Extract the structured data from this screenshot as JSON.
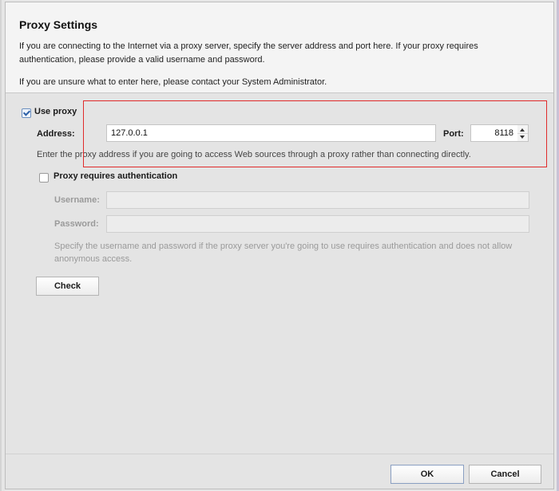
{
  "header": {
    "title": "Proxy Settings",
    "description": "If you are connecting to the Internet via a proxy server, specify the server address and port here. If your proxy requires authentication, please provide a valid username and password.",
    "unsure_text": "If you are unsure what to enter here, please contact your System Administrator."
  },
  "proxy": {
    "use_proxy_label": "Use proxy",
    "use_proxy_checked": true,
    "address_label": "Address:",
    "address_value": "127.0.0.1",
    "port_label": "Port:",
    "port_value": "8118",
    "hint": "Enter the proxy address if you are going to access Web sources through a proxy rather than connecting directly."
  },
  "auth": {
    "requires_label": "Proxy requires authentication",
    "requires_checked": false,
    "username_label": "Username:",
    "username_value": "",
    "password_label": "Password:",
    "password_value": "",
    "hint": "Specify the username and password if the proxy server you're going to use requires authentication and does not allow anonymous access."
  },
  "buttons": {
    "check": "Check",
    "ok": "OK",
    "cancel": "Cancel"
  },
  "icons": {
    "checkbox_checked": "checkmark-icon",
    "spinner_up": "arrow-up-icon",
    "spinner_down": "arrow-down-icon"
  },
  "colors": {
    "highlight_box": "#e02b2b",
    "accent": "#2f62a8"
  }
}
